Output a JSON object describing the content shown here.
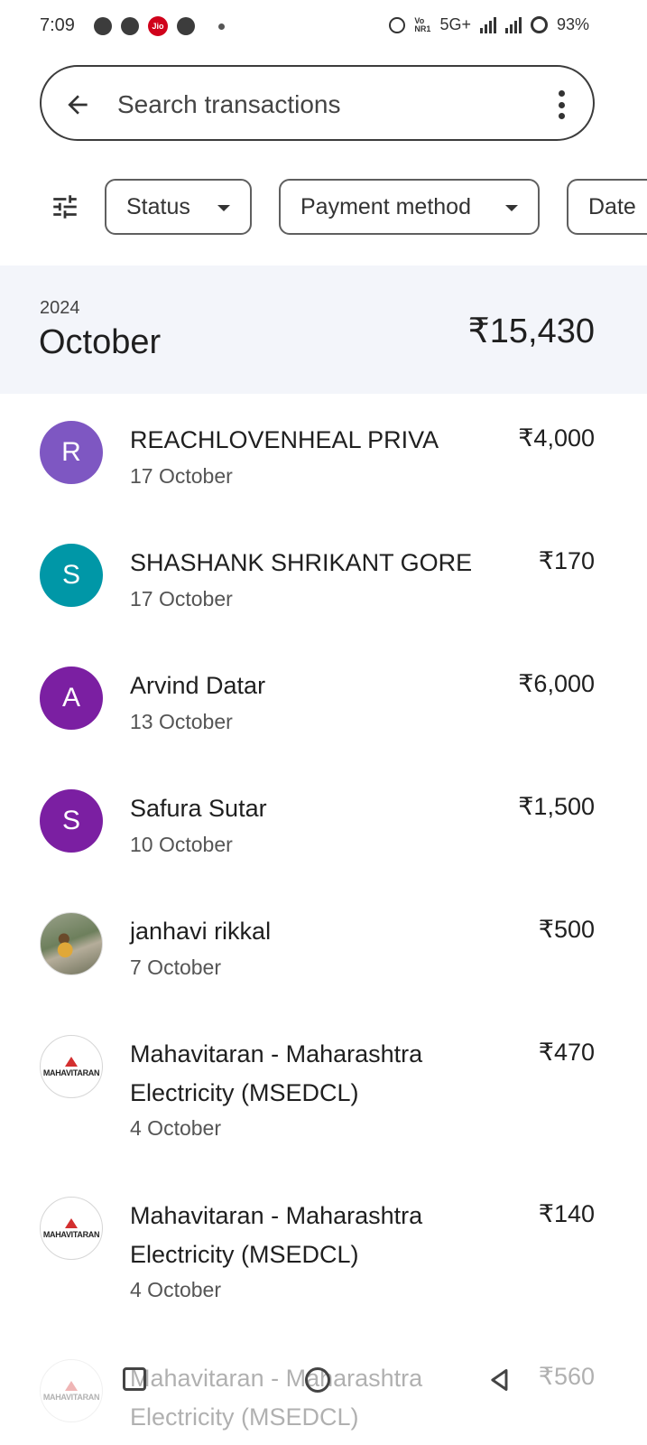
{
  "status_bar": {
    "time": "7:09",
    "jio_label": "Jio",
    "volte": "Vo\nNR1",
    "network": "5G+",
    "battery": "93%"
  },
  "search": {
    "placeholder": "Search transactions"
  },
  "filters": {
    "status_label": "Status",
    "method_label": "Payment method",
    "date_label": "Date"
  },
  "month": {
    "year": "2024",
    "name": "October",
    "total": "₹15,430"
  },
  "transactions": [
    {
      "initial": "R",
      "color": "#7e57c2",
      "name": "REACHLOVENHEAL PRIVA",
      "date": "17 October",
      "amount": "₹4,000"
    },
    {
      "initial": "S",
      "color": "#0097a7",
      "name": "SHASHANK SHRIKANT GORE",
      "date": "17 October",
      "amount": "₹170"
    },
    {
      "initial": "A",
      "color": "#7b1fa2",
      "name": "Arvind Datar",
      "date": "13 October",
      "amount": "₹6,000"
    },
    {
      "initial": "S",
      "color": "#7b1fa2",
      "name": "Safura Sutar",
      "date": "10 October",
      "amount": "₹1,500"
    },
    {
      "initial": "",
      "color": "",
      "name": "janhavi rikkal",
      "date": "7 October",
      "amount": "₹500"
    },
    {
      "logo_text": "MAHAVITARAN",
      "name": "Mahavitaran - Maharashtra Electricity (MSEDCL)",
      "date": "4 October",
      "amount": "₹470"
    },
    {
      "logo_text": "MAHAVITARAN",
      "name": "Mahavitaran - Maharashtra Electricity (MSEDCL)",
      "date": "4 October",
      "amount": "₹140"
    },
    {
      "logo_text": "MAHAVITARAN",
      "name": "Mahavitaran - Maharashtra Electricity (MSEDCL)",
      "date": "",
      "amount": "₹560"
    }
  ],
  "icons": {
    "back": "arrow-left",
    "more": "more-vert",
    "tune": "tune",
    "nav_recents": "square",
    "nav_home": "circle",
    "nav_back": "triangle-left"
  }
}
